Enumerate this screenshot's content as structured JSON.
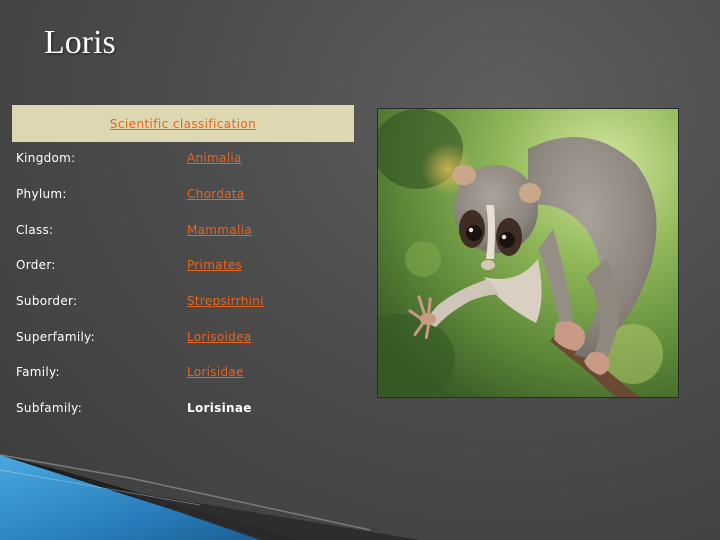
{
  "slide": {
    "title": "Loris"
  },
  "classification": {
    "header": "Scientific classification",
    "rows": [
      {
        "label": "Kingdom:",
        "value": "Animalia"
      },
      {
        "label": "Phylum:",
        "value": "Chordata"
      },
      {
        "label": "Class:",
        "value": "Mammalia"
      },
      {
        "label": "Order:",
        "value": "Primates"
      },
      {
        "label": "Suborder:",
        "value": "Strepsirrhini"
      },
      {
        "label": "Superfamily:",
        "value": "Lorisoidea"
      },
      {
        "label": "Family:",
        "value": "Lorisidae"
      },
      {
        "label": "Subfamily:",
        "value": "Lorisinae"
      }
    ]
  },
  "colors": {
    "link": "#e8651f",
    "header_bg": "#ddd7b2",
    "accent_blue": "#2f86c4"
  }
}
